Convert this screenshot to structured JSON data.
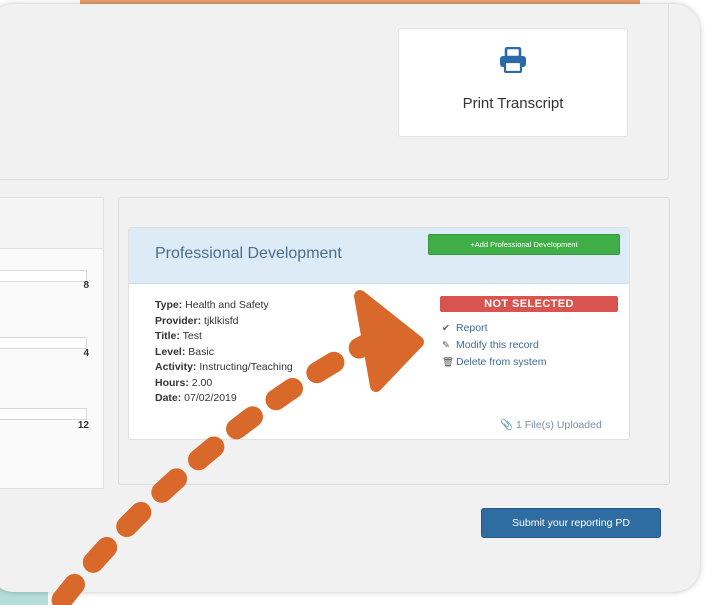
{
  "print": {
    "label": "Print Transcript",
    "icon": "printer-icon"
  },
  "left_counts": [
    "8",
    "4",
    "12"
  ],
  "pd": {
    "title": "Professional Development",
    "add_button": "+Add Professional Development",
    "status": "NOT SELECTED",
    "fields": [
      {
        "label": "Type:",
        "value": " Health and Safety"
      },
      {
        "label": "Provider:",
        "value": " tjklkisfd"
      },
      {
        "label": "Title:",
        "value": " Test"
      },
      {
        "label": "Level:",
        "value": " Basic"
      },
      {
        "label": "Activity:",
        "value": " Instructing/Teaching"
      },
      {
        "label": "Hours:",
        "value": " 2.00"
      },
      {
        "label": "Date:",
        "value": " 07/02/2019"
      }
    ],
    "actions": [
      {
        "icon": "check-icon",
        "glyph": "✔",
        "label": "Report"
      },
      {
        "icon": "pencil-icon",
        "glyph": "✎",
        "label": "Modify this record"
      },
      {
        "icon": "trash-icon",
        "glyph": "🗑",
        "label": "Delete from system"
      }
    ],
    "files": "1 File(s) Uploaded",
    "files_icon": "paperclip-icon"
  },
  "submit_button": "Submit your reporting PD",
  "colors": {
    "accent_green": "#3fae47",
    "status_red": "#d9534f",
    "primary_blue": "#2f6ca2",
    "annotation_orange": "#d9692a"
  }
}
